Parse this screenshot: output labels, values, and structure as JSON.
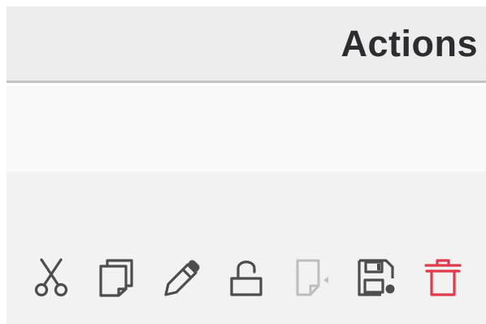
{
  "header": {
    "title": "Actions"
  },
  "actions": [
    {
      "id": "cut",
      "icon": "scissors-icon",
      "enabled": true
    },
    {
      "id": "copy",
      "icon": "copy-icon",
      "enabled": true
    },
    {
      "id": "edit",
      "icon": "pencil-icon",
      "enabled": true
    },
    {
      "id": "unlock",
      "icon": "unlock-icon",
      "enabled": true
    },
    {
      "id": "move",
      "icon": "move-file-icon",
      "enabled": false
    },
    {
      "id": "save",
      "icon": "save-icon",
      "enabled": true
    },
    {
      "id": "delete",
      "icon": "trash-icon",
      "enabled": true
    }
  ],
  "colors": {
    "icon": "#4d4d4d",
    "icon_disabled": "#bdbdbd",
    "delete": "#e03a4b",
    "header_bg": "#ededed",
    "header_border": "#c4c4c4",
    "title": "#2b2d30"
  }
}
